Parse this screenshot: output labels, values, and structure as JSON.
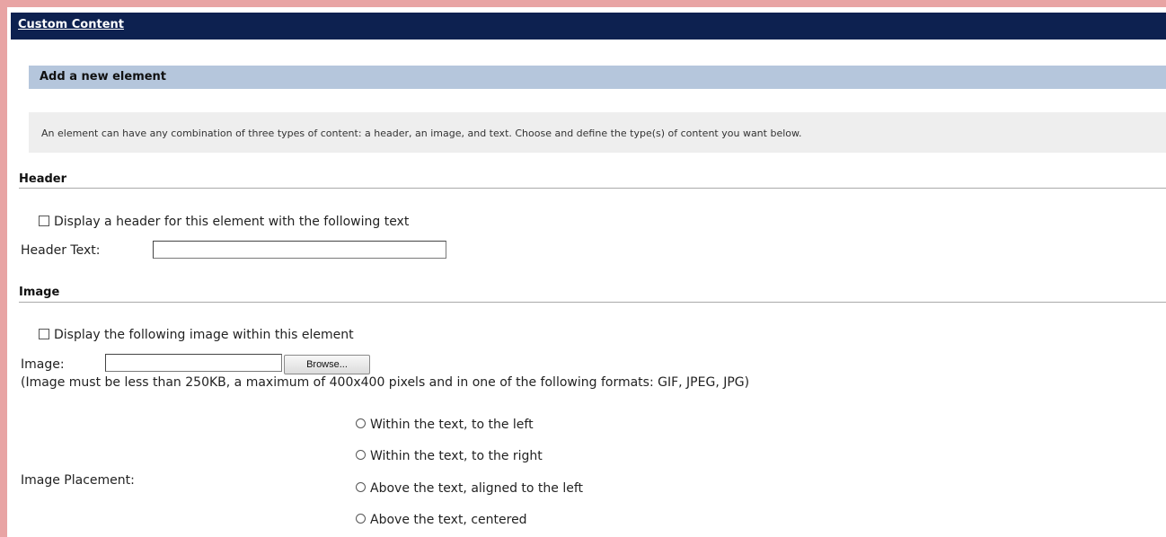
{
  "topbar": {
    "title": "Custom Content"
  },
  "section": {
    "title": "Add a new element"
  },
  "intro": {
    "text": "An element can have any combination of three types of content: a header, an image, and text. Choose and define the type(s) of content you want below."
  },
  "header_group": {
    "title": "Header",
    "checkbox_label": "Display a header for this element with the following text",
    "text_label": "Header Text:",
    "text_value": ""
  },
  "image_group": {
    "title": "Image",
    "checkbox_label": "Display the following image within this element",
    "image_label": "Image:",
    "image_value": "",
    "browse_label": "Browse...",
    "note": "(Image must be less than 250KB, a maximum of 400x400 pixels and in one of the following formats: GIF, JPEG, JPG)",
    "placement_label": "Image Placement:",
    "placement_options": [
      "Within the text, to the left",
      "Within the text, to the right",
      "Above the text, aligned to the left",
      "Above the text, centered"
    ]
  }
}
